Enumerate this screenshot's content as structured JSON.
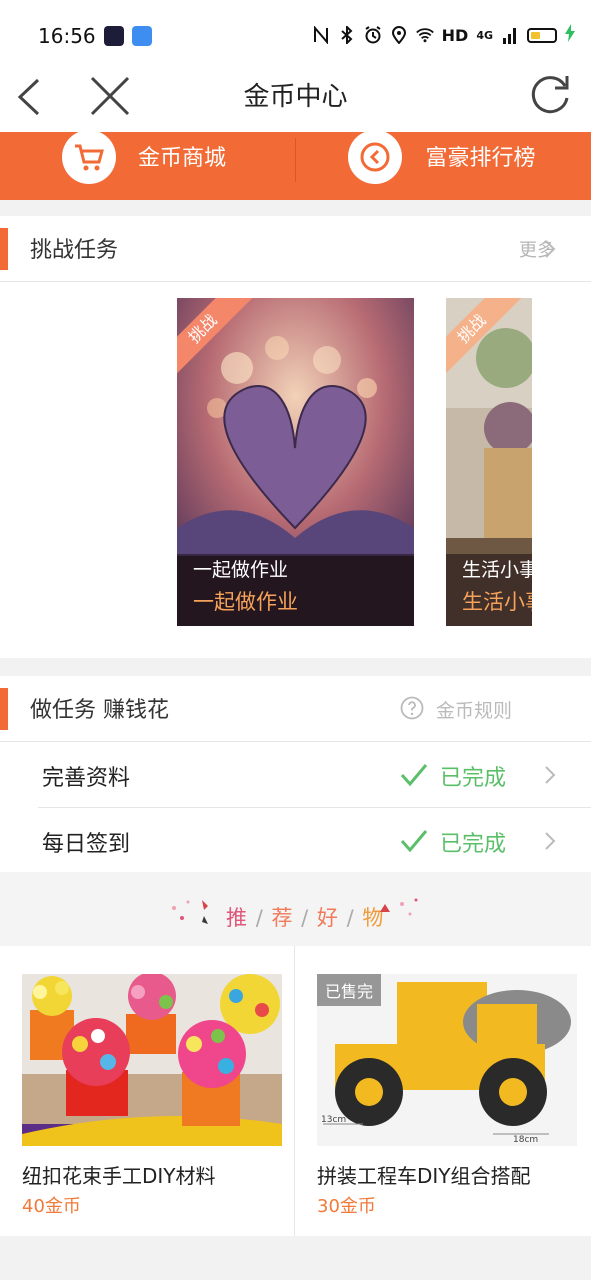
{
  "status_bar": {
    "time": "16:56",
    "network": "HD",
    "signal": "4G",
    "icons": [
      "nfc-icon",
      "bluetooth-icon",
      "alarm-icon",
      "location-icon",
      "wifi-icon",
      "battery-icon"
    ]
  },
  "nav": {
    "title": "金币中心"
  },
  "shortcuts": [
    {
      "label": "金币商城",
      "icon": "cart-icon"
    },
    {
      "label": "富豪排行榜",
      "icon": "coin-icon"
    }
  ],
  "challenge": {
    "title": "挑战任务",
    "more": "更多",
    "cards": [
      {
        "ribbon": "挑战",
        "title": "一起做作业",
        "subtitle": "一起做作业"
      },
      {
        "ribbon": "挑战",
        "title": "生活小事",
        "subtitle": "生活小事"
      }
    ]
  },
  "tasks": {
    "title": "做任务 赚钱花",
    "rules": "金币规则",
    "items": [
      {
        "name": "完善资料",
        "status": "已完成"
      },
      {
        "name": "每日签到",
        "status": "已完成"
      }
    ]
  },
  "recommend": {
    "title_chars": [
      "推",
      "荐",
      "好",
      "物"
    ],
    "separator": "/",
    "goods": [
      {
        "name": "纽扣花束手工DIY材料",
        "price": "40金币",
        "sold_tag": ""
      },
      {
        "name": "拼装工程车DIY组合搭配",
        "price": "30金币",
        "sold_tag": "已售完",
        "dim_a": "13cm",
        "dim_b": "18cm"
      }
    ]
  },
  "colors": {
    "accent": "#f26b36",
    "success": "#5bbf6a",
    "price": "#f07a3a",
    "recommend": "#e0557a"
  }
}
